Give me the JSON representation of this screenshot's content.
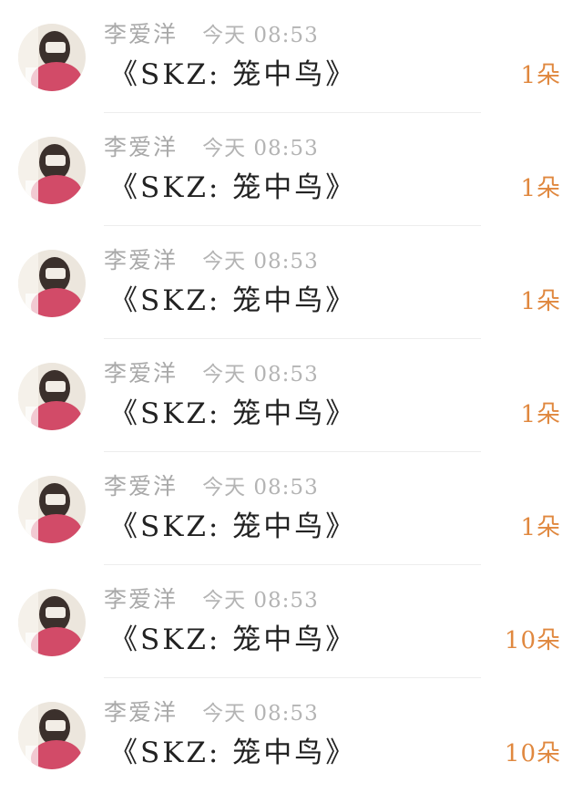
{
  "messages": [
    {
      "name": "李爱洋",
      "time": "今天 08:53",
      "text": "《SKZ: 笼中鸟》",
      "count": "1朵"
    },
    {
      "name": "李爱洋",
      "time": "今天 08:53",
      "text": "《SKZ: 笼中鸟》",
      "count": "1朵"
    },
    {
      "name": "李爱洋",
      "time": "今天 08:53",
      "text": "《SKZ: 笼中鸟》",
      "count": "1朵"
    },
    {
      "name": "李爱洋",
      "time": "今天 08:53",
      "text": "《SKZ: 笼中鸟》",
      "count": "1朵"
    },
    {
      "name": "李爱洋",
      "time": "今天 08:53",
      "text": "《SKZ: 笼中鸟》",
      "count": "1朵"
    },
    {
      "name": "李爱洋",
      "time": "今天 08:53",
      "text": "《SKZ: 笼中鸟》",
      "count": "10朵"
    },
    {
      "name": "李爱洋",
      "time": "今天 08:53",
      "text": "《SKZ: 笼中鸟》",
      "count": "10朵"
    }
  ],
  "colors": {
    "name": "#a9a9a9",
    "time": "#b4b4b4",
    "message": "#222222",
    "count": "#e0883f",
    "divider": "#ededed"
  }
}
